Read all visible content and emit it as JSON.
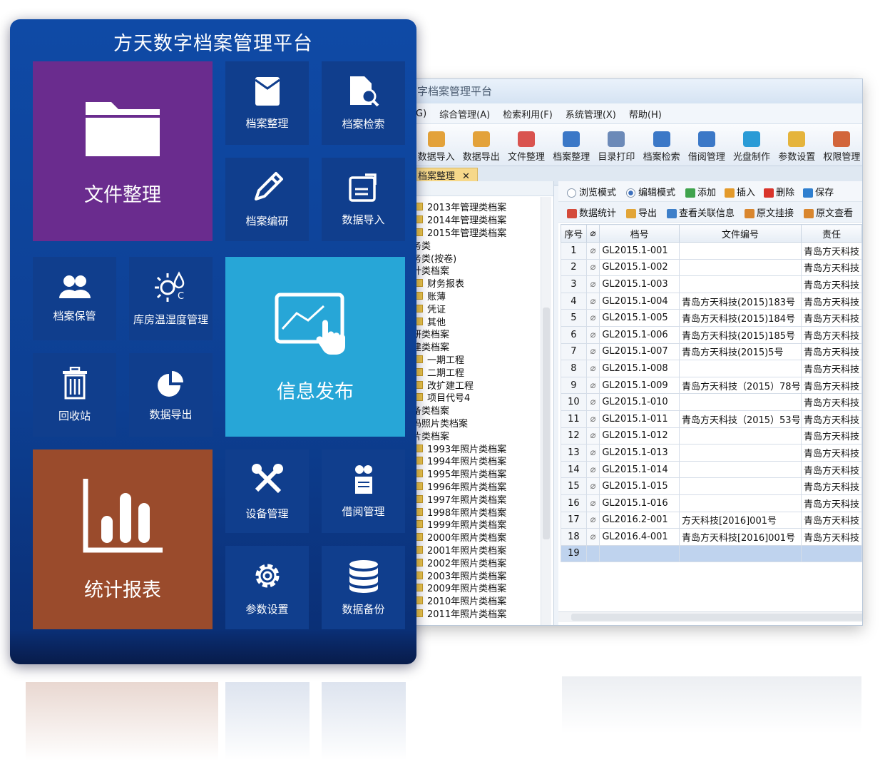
{
  "panel": {
    "title": "方天数字档案管理平台",
    "tiles": {
      "file_organize": "文件整理",
      "archive_organize": "档案整理",
      "archive_search": "档案检索",
      "archive_compile": "档案编研",
      "data_import": "数据导入",
      "archive_keep": "档案保管",
      "warehouse_temp": "库房温湿度管理",
      "info_publish": "信息发布",
      "recycle_bin": "回收站",
      "data_export": "数据导出",
      "statistics": "统计报表",
      "device_mgmt": "设备管理",
      "borrow_mgmt": "借阅管理",
      "settings": "参数设置",
      "data_backup": "数据备份"
    }
  },
  "app": {
    "title": "字档案管理平台",
    "menu": [
      "G)",
      "综合管理(A)",
      "检索利用(F)",
      "系统管理(X)",
      "帮助(H)"
    ],
    "toolbar": [
      "数据导入",
      "数据导出",
      "文件整理",
      "档案整理",
      "目录打印",
      "档案检索",
      "借阅管理",
      "光盘制作",
      "参数设置",
      "权限管理"
    ],
    "doc_tab": "档案整理",
    "view_modes": {
      "browse": "浏览模式",
      "edit": "编辑模式"
    },
    "actions_row1": [
      "添加",
      "插入",
      "删除",
      "保存"
    ],
    "actions_row2": [
      "数据统计",
      "导出",
      "查看关联信息",
      "原文挂接",
      "原文查看"
    ],
    "tree": [
      {
        "label": "2013年管理类档案",
        "level": 1
      },
      {
        "label": "2014年管理类档案",
        "level": 1
      },
      {
        "label": "2015年管理类档案",
        "level": 1
      },
      {
        "label": "业务类",
        "level": 0
      },
      {
        "label": "业务类(按卷)",
        "level": 0
      },
      {
        "label": "会计类档案",
        "level": 0
      },
      {
        "label": "财务报表",
        "level": 1
      },
      {
        "label": "账薄",
        "level": 1
      },
      {
        "label": "凭证",
        "level": 1
      },
      {
        "label": "其他",
        "level": 1
      },
      {
        "label": "科研类档案",
        "level": 0
      },
      {
        "label": "基建类档案",
        "level": 0
      },
      {
        "label": "一期工程",
        "level": 1
      },
      {
        "label": "二期工程",
        "level": 1
      },
      {
        "label": "改扩建工程",
        "level": 1
      },
      {
        "label": "项目代号4",
        "level": 1
      },
      {
        "label": "设备类档案",
        "level": 0
      },
      {
        "label": "数码照片类档案",
        "level": 0
      },
      {
        "label": "照片类档案",
        "level": 0
      },
      {
        "label": "1993年照片类档案",
        "level": 1
      },
      {
        "label": "1994年照片类档案",
        "level": 1
      },
      {
        "label": "1995年照片类档案",
        "level": 1
      },
      {
        "label": "1996年照片类档案",
        "level": 1
      },
      {
        "label": "1997年照片类档案",
        "level": 1
      },
      {
        "label": "1998年照片类档案",
        "level": 1
      },
      {
        "label": "1999年照片类档案",
        "level": 1
      },
      {
        "label": "2000年照片类档案",
        "level": 1
      },
      {
        "label": "2001年照片类档案",
        "level": 1
      },
      {
        "label": "2002年照片类档案",
        "level": 1
      },
      {
        "label": "2003年照片类档案",
        "level": 1
      },
      {
        "label": "2009年照片类档案",
        "level": 1
      },
      {
        "label": "2010年照片类档案",
        "level": 1
      },
      {
        "label": "2011年照片类档案",
        "level": 1
      }
    ],
    "grid": {
      "headers": [
        "序号",
        "档号",
        "文件编号",
        "责任"
      ],
      "rows": [
        [
          "1",
          "GL2015.1-001",
          "",
          "青岛方天科技"
        ],
        [
          "2",
          "GL2015.1-002",
          "",
          "青岛方天科技"
        ],
        [
          "3",
          "GL2015.1-003",
          "",
          "青岛方天科技"
        ],
        [
          "4",
          "GL2015.1-004",
          "青岛方天科技(2015)183号",
          "青岛方天科技"
        ],
        [
          "5",
          "GL2015.1-005",
          "青岛方天科技(2015)184号",
          "青岛方天科技"
        ],
        [
          "6",
          "GL2015.1-006",
          "青岛方天科技(2015)185号",
          "青岛方天科技"
        ],
        [
          "7",
          "GL2015.1-007",
          "青岛方天科技(2015)5号",
          "青岛方天科技"
        ],
        [
          "8",
          "GL2015.1-008",
          "",
          "青岛方天科技"
        ],
        [
          "9",
          "GL2015.1-009",
          "青岛方天科技（2015）78号",
          "青岛方天科技"
        ],
        [
          "10",
          "GL2015.1-010",
          "",
          "青岛方天科技"
        ],
        [
          "11",
          "GL2015.1-011",
          "青岛方天科技（2015）53号",
          "青岛方天科技"
        ],
        [
          "12",
          "GL2015.1-012",
          "",
          "青岛方天科技"
        ],
        [
          "13",
          "GL2015.1-013",
          "",
          "青岛方天科技"
        ],
        [
          "14",
          "GL2015.1-014",
          "",
          "青岛方天科技"
        ],
        [
          "15",
          "GL2015.1-015",
          "",
          "青岛方天科技"
        ],
        [
          "16",
          "GL2015.1-016",
          "",
          "青岛方天科技"
        ],
        [
          "17",
          "GL2016.2-001",
          "方天科技[2016]001号",
          "青岛方天科技"
        ],
        [
          "18",
          "GL2016.4-001",
          "青岛方天科技[2016]001号",
          "青岛方天科技"
        ],
        [
          "19",
          "",
          "",
          ""
        ]
      ]
    }
  }
}
